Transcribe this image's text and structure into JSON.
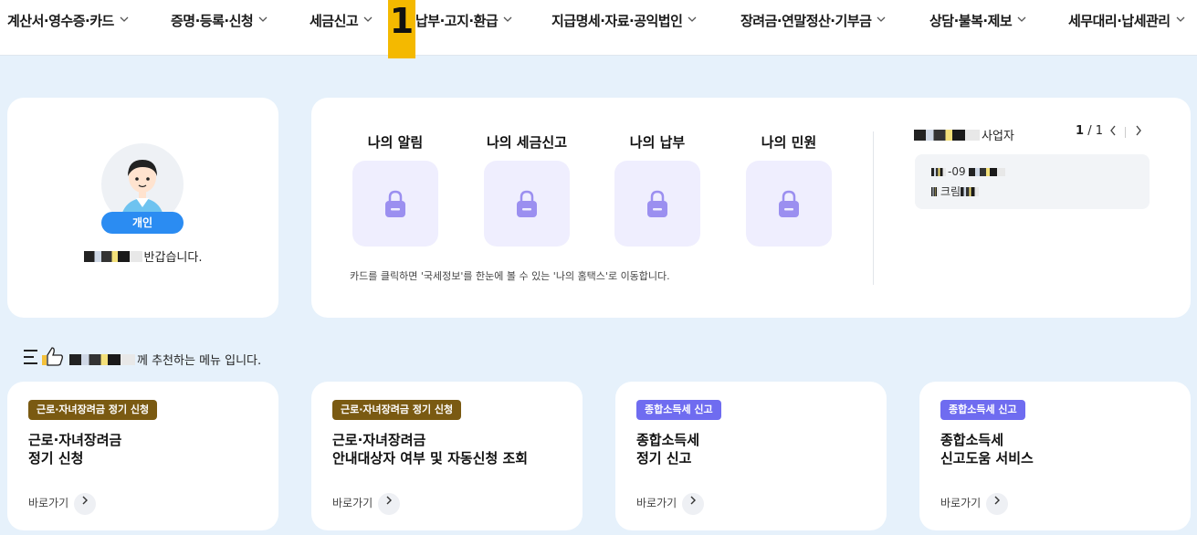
{
  "nav": {
    "items": [
      "계산서·영수증·카드",
      "증명·등록·신청",
      "세금신고",
      "납부·고지·환급",
      "지급명세·자료·공익법인",
      "장려금·연말정산·기부금",
      "상담·불복·제보",
      "세무대리·납세관리"
    ],
    "step_badge": "1"
  },
  "profile": {
    "badge": "개인",
    "greeting_suffix": "반갑습니다."
  },
  "my_service": {
    "tiles": [
      "나의 알림",
      "나의 세금신고",
      "나의 납부",
      "나의 민원"
    ],
    "note": "카드를 클릭하면 '국세정보'를 한눈에 볼 수 있는 '나의 홈택스'로 이동합니다.",
    "business_label": "사업자",
    "pager_current": "1",
    "pager_total": "/ 1",
    "biz_number": "-09",
    "biz_name": "크림"
  },
  "recommend": {
    "heading_suffix": "께 추천하는 메뉴 입니다.",
    "cards": [
      {
        "tag": "근로·자녀장려금 정기 신청",
        "tag_color": "#7a5a12",
        "title": "근로·자녀장려금\n정기 신청",
        "link": "바로가기"
      },
      {
        "tag": "근로·자녀장려금 정기 신청",
        "tag_color": "#7a5a12",
        "title": "근로·자녀장려금\n안내대상자 여부 및 자동신청 조회",
        "link": "바로가기"
      },
      {
        "tag": "종합소득세 신고",
        "tag_color": "#6f6cf0",
        "title": "종합소득세\n정기 신고",
        "link": "바로가기"
      },
      {
        "tag": "종합소득세 신고",
        "tag_color": "#6f6cf0",
        "title": "종합소득세\n신고도움 서비스",
        "link": "바로가기"
      }
    ]
  },
  "colors": {
    "page_bg": "#e6f1fb",
    "accent_blue": "#2b8cf2",
    "tile_bg": "#efeefe",
    "lock": "#9b8ff0",
    "step_badge": "#f4b900"
  }
}
